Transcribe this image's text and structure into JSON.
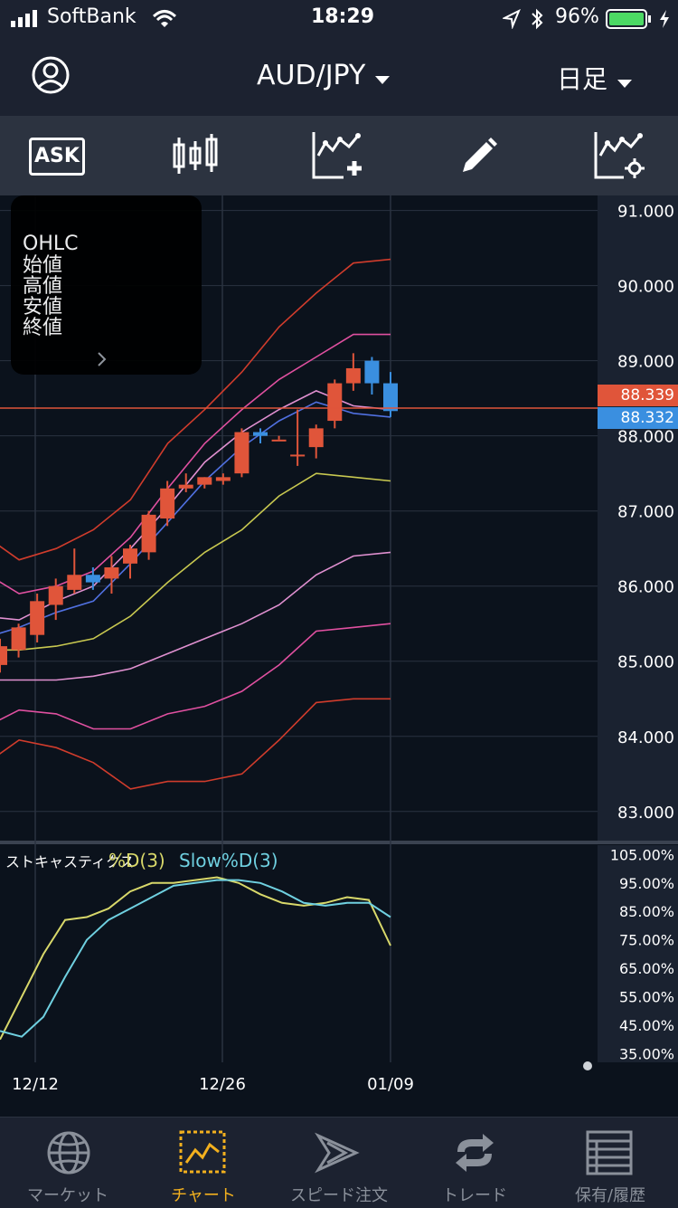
{
  "status_bar": {
    "carrier": "SoftBank",
    "time": "18:29",
    "battery": "96%"
  },
  "header": {
    "pair": "AUD/JPY",
    "timeframe": "日足"
  },
  "toolbar": {
    "ask_label": "ASK"
  },
  "ohlc_panel": {
    "title": "OHLC",
    "open_label": "始値",
    "high_label": "高値",
    "low_label": "安値",
    "close_label": "終値"
  },
  "price_tags": {
    "ask": "88.339",
    "bid": "88.332",
    "ask_color": "#e0553a",
    "bid_color": "#3a8fe0"
  },
  "stochastics": {
    "name": "ストキャスティクス",
    "d_label": "%D(3)",
    "slow_label": "Slow%D(3)",
    "d_color": "#d8d86a",
    "slow_color": "#6fd0e0"
  },
  "chart_data": {
    "type": "candlestick",
    "price_axis_ticks": [
      "91.000",
      "90.000",
      "89.000",
      "88.000",
      "87.000",
      "86.000",
      "85.000",
      "84.000",
      "83.000"
    ],
    "price_range": [
      82.6,
      91.2
    ],
    "stoch_axis_ticks": [
      "105.00%",
      "95.00%",
      "85.00%",
      "75.00%",
      "65.00%",
      "55.00%",
      "45.00%",
      "35.00%"
    ],
    "stoch_range": [
      32,
      107
    ],
    "x_labels": [
      "12/12",
      "12/26",
      "01/09"
    ],
    "candles": [
      {
        "o": 84.95,
        "h": 85.3,
        "l": 84.85,
        "c": 85.2,
        "dir": "up"
      },
      {
        "o": 85.15,
        "h": 85.5,
        "l": 85.05,
        "c": 85.45,
        "dir": "up"
      },
      {
        "o": 85.35,
        "h": 85.9,
        "l": 85.25,
        "c": 85.8,
        "dir": "up"
      },
      {
        "o": 85.75,
        "h": 86.1,
        "l": 85.55,
        "c": 86.0,
        "dir": "up"
      },
      {
        "o": 85.95,
        "h": 86.5,
        "l": 85.9,
        "c": 86.15,
        "dir": "up"
      },
      {
        "o": 86.15,
        "h": 86.25,
        "l": 85.95,
        "c": 86.05,
        "dir": "down"
      },
      {
        "o": 86.1,
        "h": 86.4,
        "l": 85.9,
        "c": 86.25,
        "dir": "up"
      },
      {
        "o": 86.3,
        "h": 86.55,
        "l": 86.1,
        "c": 86.5,
        "dir": "up"
      },
      {
        "o": 86.45,
        "h": 87.0,
        "l": 86.35,
        "c": 86.95,
        "dir": "up"
      },
      {
        "o": 86.9,
        "h": 87.4,
        "l": 86.8,
        "c": 87.3,
        "dir": "up"
      },
      {
        "o": 87.3,
        "h": 87.5,
        "l": 87.25,
        "c": 87.35,
        "dir": "up"
      },
      {
        "o": 87.35,
        "h": 87.45,
        "l": 87.3,
        "c": 87.45,
        "dir": "up"
      },
      {
        "o": 87.4,
        "h": 87.5,
        "l": 87.35,
        "c": 87.45,
        "dir": "up"
      },
      {
        "o": 87.5,
        "h": 88.1,
        "l": 87.45,
        "c": 88.05,
        "dir": "up"
      },
      {
        "o": 88.0,
        "h": 88.1,
        "l": 87.9,
        "c": 88.05,
        "dir": "down"
      },
      {
        "o": 87.95,
        "h": 88.0,
        "l": 87.95,
        "c": 87.95,
        "dir": "up"
      },
      {
        "o": 87.75,
        "h": 88.35,
        "l": 87.6,
        "c": 87.75,
        "dir": "up"
      },
      {
        "o": 87.85,
        "h": 88.15,
        "l": 87.7,
        "c": 88.1,
        "dir": "up"
      },
      {
        "o": 88.2,
        "h": 88.75,
        "l": 88.1,
        "c": 88.7,
        "dir": "up"
      },
      {
        "o": 88.7,
        "h": 89.1,
        "l": 88.6,
        "c": 88.9,
        "dir": "up"
      },
      {
        "o": 89.0,
        "h": 89.05,
        "l": 88.55,
        "c": 88.7,
        "dir": "down"
      },
      {
        "o": 88.7,
        "h": 88.85,
        "l": 88.25,
        "c": 88.33,
        "dir": "down"
      }
    ],
    "bands": [
      {
        "color": "#d03c2c",
        "values": [
          86.7,
          86.35,
          86.5,
          86.75,
          87.15,
          87.9,
          88.35,
          88.85,
          89.45,
          89.9,
          90.3,
          90.35
        ]
      },
      {
        "color": "#e050a0",
        "values": [
          86.2,
          85.9,
          86.0,
          86.2,
          86.65,
          87.3,
          87.9,
          88.35,
          88.75,
          89.05,
          89.35,
          89.35
        ]
      },
      {
        "color": "#e090d0",
        "values": [
          85.6,
          85.55,
          85.8,
          86.0,
          86.5,
          87.05,
          87.65,
          88.05,
          88.35,
          88.6,
          88.4,
          88.35
        ]
      },
      {
        "color": "#5070e0",
        "values": [
          85.3,
          85.45,
          85.65,
          85.8,
          86.3,
          86.85,
          87.4,
          87.85,
          88.2,
          88.45,
          88.3,
          88.25
        ]
      },
      {
        "color": "#c8c850",
        "values": [
          85.15,
          85.15,
          85.2,
          85.3,
          85.6,
          86.05,
          86.45,
          86.75,
          87.2,
          87.5,
          87.45,
          87.4
        ]
      },
      {
        "color": "#e090d0",
        "values": [
          84.75,
          84.75,
          84.75,
          84.8,
          84.9,
          85.1,
          85.3,
          85.5,
          85.75,
          86.15,
          86.4,
          86.45
        ]
      },
      {
        "color": "#e050a0",
        "values": [
          84.1,
          84.35,
          84.3,
          84.1,
          84.1,
          84.3,
          84.4,
          84.6,
          84.95,
          85.4,
          85.45,
          85.5
        ]
      },
      {
        "color": "#d03c2c",
        "values": [
          83.6,
          83.95,
          83.85,
          83.65,
          83.3,
          83.4,
          83.4,
          83.5,
          83.95,
          84.45,
          84.5,
          84.5
        ]
      }
    ],
    "stoch_d": [
      40,
      55,
      70,
      82,
      83,
      86,
      92,
      95,
      95,
      96,
      97,
      95,
      91,
      88,
      87,
      88,
      90,
      89,
      73
    ],
    "stoch_slow": [
      43,
      41,
      48,
      62,
      75,
      82,
      86,
      90,
      94,
      95,
      96,
      96,
      95,
      92,
      88,
      87,
      88,
      88,
      83
    ]
  },
  "tabs": [
    {
      "label": "マーケット"
    },
    {
      "label": "チャート"
    },
    {
      "label": "スピード注文"
    },
    {
      "label": "トレード"
    },
    {
      "label": "保有/履歴"
    }
  ]
}
